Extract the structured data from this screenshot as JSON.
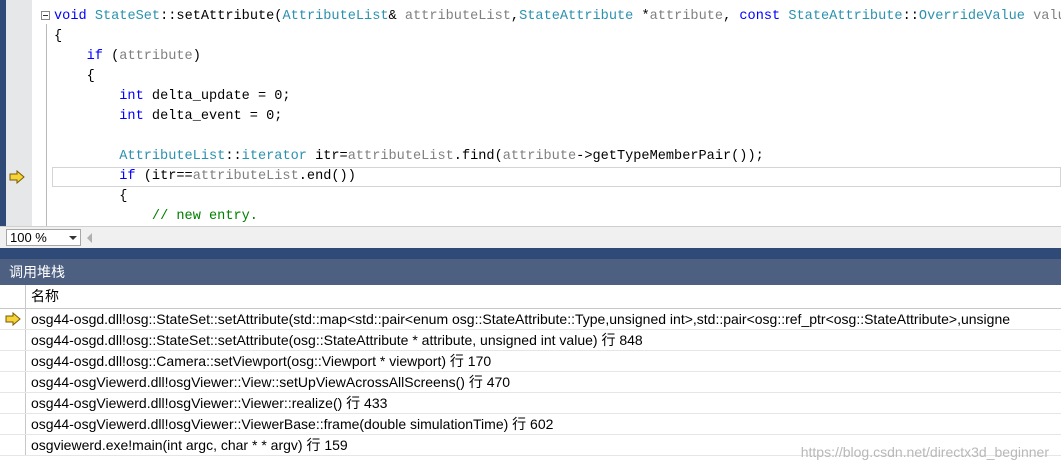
{
  "editor": {
    "lines": [
      [
        {
          "t": "void",
          "c": "kw"
        },
        {
          "t": " "
        },
        {
          "t": "StateSet",
          "c": "ty"
        },
        {
          "t": "::"
        },
        {
          "t": "setAttribute("
        },
        {
          "t": "AttributeList",
          "c": "ty"
        },
        {
          "t": "& "
        },
        {
          "t": "attributeList",
          "c": "gr"
        },
        {
          "t": ","
        },
        {
          "t": "StateAttribute",
          "c": "ty"
        },
        {
          "t": " *"
        },
        {
          "t": "attribute",
          "c": "gr"
        },
        {
          "t": ", "
        },
        {
          "t": "const",
          "c": "kw"
        },
        {
          "t": " "
        },
        {
          "t": "StateAttribute",
          "c": "ty"
        },
        {
          "t": "::"
        },
        {
          "t": "OverrideValue",
          "c": "ty"
        },
        {
          "t": " "
        },
        {
          "t": "value",
          "c": "gr"
        },
        {
          "t": ")"
        }
      ],
      [
        {
          "t": "{"
        }
      ],
      [
        {
          "t": "    "
        },
        {
          "t": "if",
          "c": "kw"
        },
        {
          "t": " ("
        },
        {
          "t": "attribute",
          "c": "gr"
        },
        {
          "t": ")"
        }
      ],
      [
        {
          "t": "    {"
        }
      ],
      [
        {
          "t": "        "
        },
        {
          "t": "int",
          "c": "kw"
        },
        {
          "t": " delta_update = 0;"
        }
      ],
      [
        {
          "t": "        "
        },
        {
          "t": "int",
          "c": "kw"
        },
        {
          "t": " delta_event = 0;"
        }
      ],
      [
        {
          "t": ""
        }
      ],
      [
        {
          "t": "        "
        },
        {
          "t": "AttributeList",
          "c": "ty"
        },
        {
          "t": "::"
        },
        {
          "t": "iterator",
          "c": "ty"
        },
        {
          "t": " itr="
        },
        {
          "t": "attributeList",
          "c": "gr"
        },
        {
          "t": ".find("
        },
        {
          "t": "attribute",
          "c": "gr"
        },
        {
          "t": "->getTypeMemberPair());"
        }
      ],
      [
        {
          "t": "        "
        },
        {
          "t": "if",
          "c": "kw"
        },
        {
          "t": " (itr=="
        },
        {
          "t": "attributeList",
          "c": "gr"
        },
        {
          "t": ".end())"
        }
      ],
      [
        {
          "t": "        {"
        }
      ],
      [
        {
          "t": "            "
        },
        {
          "t": "// new entry.",
          "c": "cm"
        }
      ]
    ],
    "current_line": 8
  },
  "zoom": {
    "value": "100 %"
  },
  "call_stack": {
    "title": "调用堆栈",
    "column_name": "名称",
    "rows": [
      {
        "text": "osg44-osgd.dll!osg::StateSet::setAttribute(std::map<std::pair<enum osg::StateAttribute::Type,unsigned int>,std::pair<osg::ref_ptr<osg::StateAttribute>,unsigne",
        "current": true
      },
      {
        "text": "osg44-osgd.dll!osg::StateSet::setAttribute(osg::StateAttribute * attribute, unsigned int value) 行 848",
        "current": false
      },
      {
        "text": "osg44-osgd.dll!osg::Camera::setViewport(osg::Viewport * viewport) 行 170",
        "current": false
      },
      {
        "text": "osg44-osgViewerd.dll!osgViewer::View::setUpViewAcrossAllScreens() 行 470",
        "current": false
      },
      {
        "text": "osg44-osgViewerd.dll!osgViewer::Viewer::realize() 行 433",
        "current": false
      },
      {
        "text": "osg44-osgViewerd.dll!osgViewer::ViewerBase::frame(double simulationTime) 行 602",
        "current": false
      },
      {
        "text": "osgviewerd.exe!main(int argc, char * * argv) 行 159",
        "current": false
      }
    ]
  },
  "watermark": "https://blog.csdn.net/directx3d_beginner",
  "colors": {
    "keyword": "#0000ff",
    "type": "#2b91af",
    "identifier_gray": "#808080",
    "comment": "#008000",
    "panel_title_bg": "#4d6082",
    "splitter": "#2f4a76",
    "exec_arrow": "#f5d33a"
  },
  "icons": {
    "exec_pointer": "current-statement-arrow-icon",
    "collapse": "collapse-minus-icon",
    "zoom_dropdown": "chevron-down-icon",
    "scroll_left": "scroll-left-arrow-icon"
  }
}
